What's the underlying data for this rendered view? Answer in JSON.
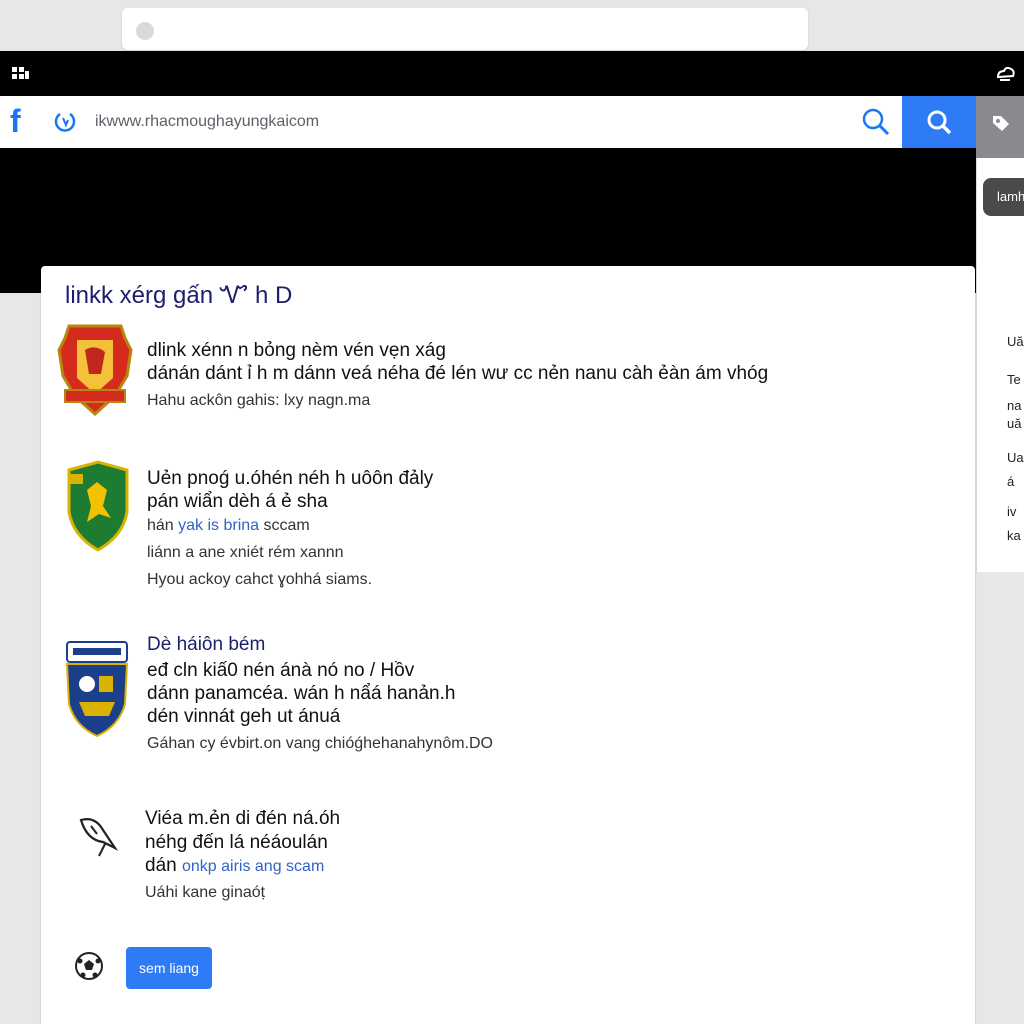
{
  "browser": {
    "url": "ikwww.rhacmoughayungkaicom"
  },
  "side_panel": {
    "pill_label": "lamh",
    "items": [
      "Uă",
      "Te",
      "na",
      "uă",
      "Ua",
      "á",
      "iv",
      "ka"
    ]
  },
  "card": {
    "title": "linkk xérg gấn Ꮙ h D",
    "results": [
      {
        "crest": "red-shield-crest-icon",
        "lines": [
          "dlink xénn n bỏng  nèm vén vẹn xág",
          "dánán dánt ỉ h m dánn veá néha đé lén wư cc nẻn nanu càh ẻàn ám vhóg"
        ],
        "meta": "Hahu ackôn gahis: lxy nagn.ma"
      },
      {
        "crest": "green-shield-crest-icon",
        "lines": [
          "Uẻn pnoǵ u.óhén néh  h uôôn đảly",
          "pán wiẩn dèh á ẻ sha"
        ],
        "link_prefix": "hán",
        "link_text": "yak is brina",
        "link_suffix": "sccam",
        "extra": "liánn a ane xniét rém xannn",
        "meta": "Hyou ackoy cahct ɣohhá siams."
      },
      {
        "crest": "blue-shield-crest-icon",
        "title": "Dè háiôn bém",
        "lines": [
          "eđ cln kiấ0 nén ánà nó no / Hồv",
          "dánn panamcéa. wán h nẩá hanản.h",
          "dén vinnát geh ut ánuá"
        ],
        "meta": "Gáhan cy évbirt.on vang chióǵhehanahynôm.DO"
      },
      {
        "crest": "feather-quill-icon",
        "lines": [
          "Viéa m.ẻn di đén ná.óh",
          "néhg đến lá néáoulán"
        ],
        "link_prefix": "dán",
        "link_text": "onkp airis ang scam",
        "meta": "Uáhi kane ginaóṭ"
      }
    ],
    "button_label": "sem liang"
  },
  "colors": {
    "accent": "#2f7bf5",
    "facebook": "#1877f2",
    "title": "#1b1f6b",
    "link": "#2f63c8"
  }
}
